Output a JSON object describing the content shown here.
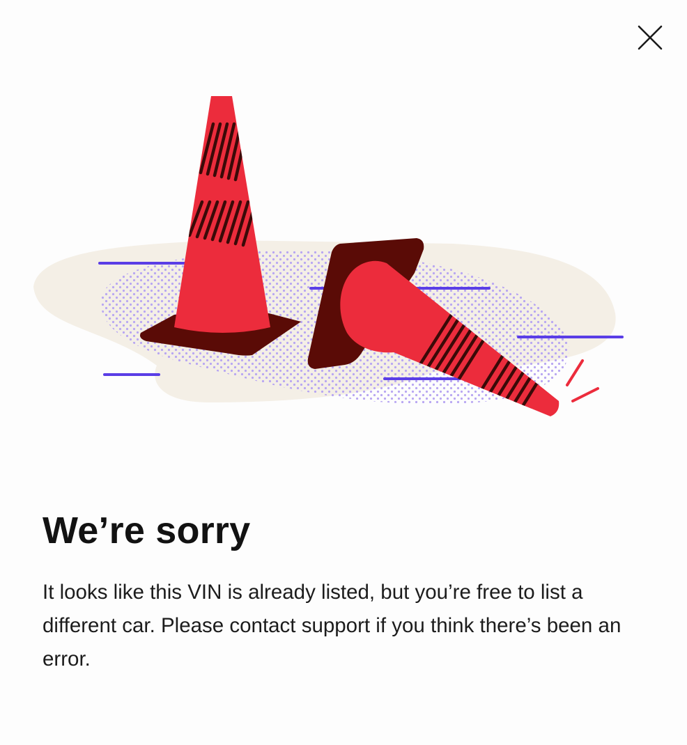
{
  "dialog": {
    "title": "We’re sorry",
    "message": "It looks like this VIN is already listed, but you’re free to list a different car. Please contact support if you think there’s been an error.",
    "close_icon": "close-icon",
    "illustration_icon": "traffic-cones-illustration"
  },
  "colors": {
    "cone_red": "#ec2c3c",
    "cone_base": "#5a0b06",
    "stripe": "#3a0a08",
    "ground": "#f4efe6",
    "speed_lines": "#5a3ee6",
    "dots": "#b8a6f2",
    "text": "#121212"
  }
}
